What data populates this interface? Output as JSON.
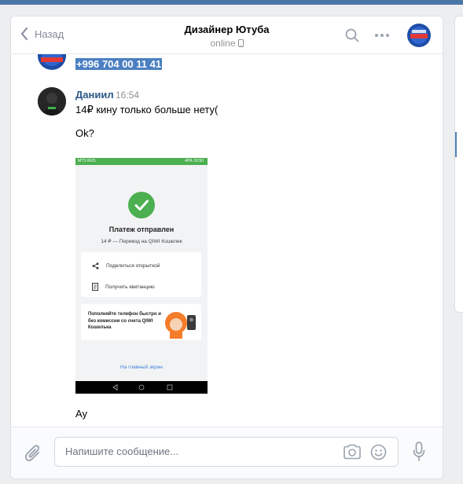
{
  "header": {
    "back_label": "Назад",
    "title": "Дизайнер Ютуба",
    "status": "online"
  },
  "messages": {
    "selected_phone": "+996 704 00 11 41",
    "author": "Даниил",
    "time": "16:54",
    "lines": [
      "14₽ кину только больше нету(",
      "Ok?",
      "Ау"
    ]
  },
  "screenshot": {
    "statusbar_left": "MTS RUS",
    "statusbar_right": "40% 16:50",
    "title": "Платеж отправлен",
    "subtitle": "14 ₽ — Перевод на QIWI Кошелек",
    "share_label": "Поделиться открыткой",
    "receipt_label": "Получить квитанцию",
    "promo_text": "Пополняйте телефон быстро и без комиссии со счета QIWI Кошелька",
    "main_link": "На главный экран",
    "brand_color": "#4caf50"
  },
  "composer": {
    "placeholder": "Напишите сообщение..."
  },
  "colors": {
    "accent": "#4a76a8",
    "link": "#2a5885",
    "selection": "#4b7fc2"
  },
  "icons": [
    "chevron-left-icon",
    "phone-icon",
    "search-icon",
    "more-icon",
    "paperclip-icon",
    "camera-icon",
    "smile-icon",
    "microphone-icon",
    "share-icon",
    "receipt-icon",
    "check-icon"
  ]
}
